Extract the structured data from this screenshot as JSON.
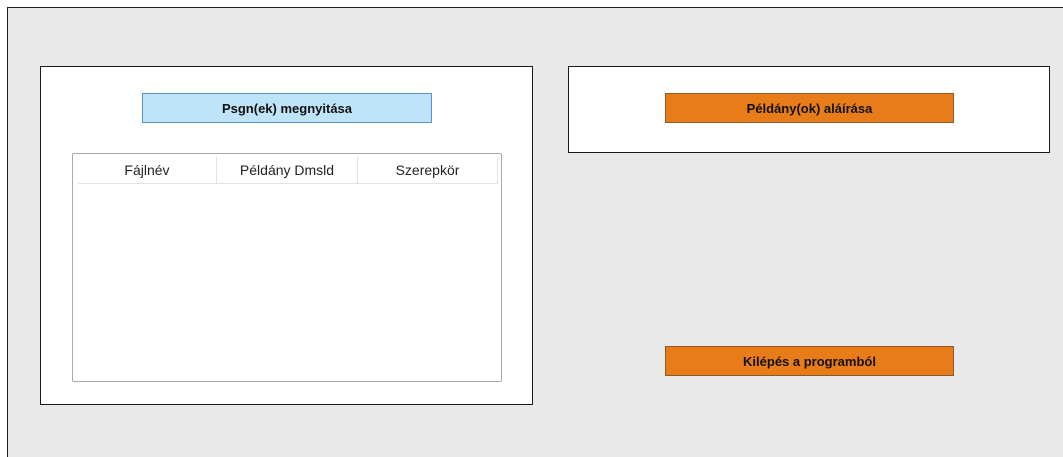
{
  "open_panel": {
    "open_button_label": "Psgn(ek) megnyitása",
    "table": {
      "columns": [
        "Fájlnév",
        "Példány Dmsld",
        "Szerepkör"
      ],
      "rows": []
    }
  },
  "sign_panel": {
    "sign_button_label": "Példány(ok) aláírása"
  },
  "exit_button_label": "Kilépés a programból",
  "colors": {
    "window_background": "#e9e9e9",
    "open_button": "#bfe4f9",
    "action_button": "#e87c18"
  }
}
